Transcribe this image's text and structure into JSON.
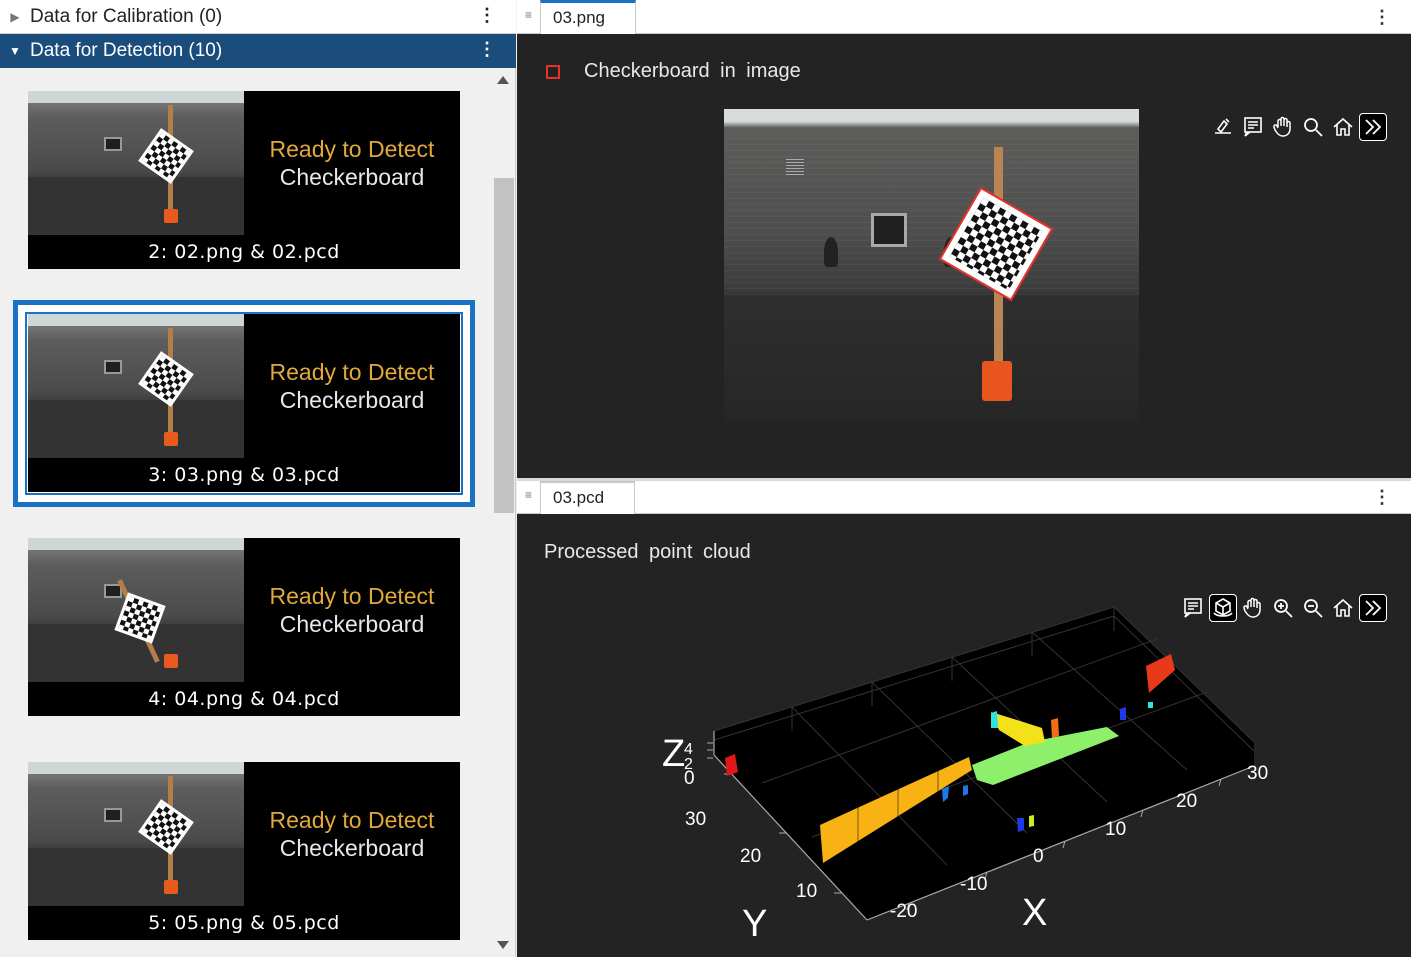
{
  "left_panel": {
    "calibration_header": {
      "label": "Data for Calibration (0)"
    },
    "detection_header": {
      "label": "Data for Detection (10)"
    },
    "items": [
      {
        "status_line1": "Ready to Detect",
        "status_line2": "Checkerboard",
        "caption": "2: 02.png & 02.pcd"
      },
      {
        "status_line1": "Ready to Detect",
        "status_line2": "Checkerboard",
        "caption": "3: 03.png & 03.pcd",
        "selected": true
      },
      {
        "status_line1": "Ready to Detect",
        "status_line2": "Checkerboard",
        "caption": "4: 04.png & 04.pcd"
      },
      {
        "status_line1": "Ready to Detect",
        "status_line2": "Checkerboard",
        "caption": "5: 05.png & 05.pcd"
      }
    ]
  },
  "image_panel": {
    "tab": "03.png",
    "legend": "Checkerboard in image",
    "toolbar": [
      "edit-export-icon",
      "datatip-icon",
      "pan-icon",
      "zoom-icon",
      "home-icon",
      "more-icon"
    ]
  },
  "pcd_panel": {
    "tab": "03.pcd",
    "title": "Processed point cloud",
    "toolbar": [
      "datatip-icon",
      "rotate-3d-icon",
      "pan-icon",
      "zoom-in-icon",
      "zoom-out-icon",
      "home-icon",
      "more-icon"
    ],
    "axes": {
      "x_label": "X",
      "y_label": "Y",
      "z_label": "Z",
      "x_ticks": [
        "-20",
        "-10",
        "0",
        "10",
        "20",
        "30"
      ],
      "y_ticks": [
        "10",
        "20",
        "30"
      ],
      "z_ticks": [
        "0",
        "2",
        "4"
      ]
    },
    "colors": {
      "accent": "#1b72c4",
      "header": "#1a4d7c",
      "status_yellow": "#e0a93a"
    }
  }
}
